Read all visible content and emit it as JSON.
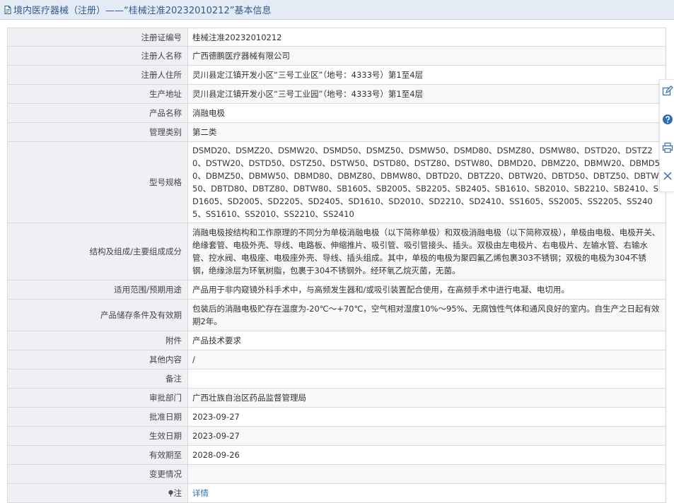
{
  "page": {
    "title": "境内医疗器械（注册）——“桂械注准20232010212”基本信息",
    "accent_color": "#2f6db5",
    "header_bg": "#e4ebf5"
  },
  "rows": [
    {
      "label": "注册证编号",
      "value": "桂械注准20232010212"
    },
    {
      "label": "注册人名称",
      "value": "广西德鹏医疗器械有限公司"
    },
    {
      "label": "注册人住所",
      "value": "灵川县定江镇开发小区“三号工业区”（地号：4333号）第1至4层"
    },
    {
      "label": "生产地址",
      "value": "灵川县定江镇开发小区“三号工业园”（地号：4333号）第1至4层"
    },
    {
      "label": "产品名称",
      "value": "消融电极"
    },
    {
      "label": "管理类别",
      "value": "第二类"
    },
    {
      "label": "型号规格",
      "value": "DSMD20、DSMZ20、DSMW20、DSMD50、DSMZ50、DSMW50、DSMD80、DSMZ80、DSMW80、DSTD20、DSTZ20、DSTW20、DSTD50、DSTZ50、DSTW50、DSTD80、DSTZ80、DSTW80、DBMD20、DBMZ20、DBMW20、DBMD50、DBMZ50、DBMW50、DBMD80、DBMZ80、DBMW80、DBTD20、DBTZ20、DBTW20、DBTD50、DBTZ50、DBTW50、DBTD80、DBTZ80、DBTW80、SB1605、SB2005、SB2205、SB2405、SB1610、SB2010、SB2210、SB2410、SD1605、SD2005、SD2205、SD2405、SD1610、SD2010、SD2210、SD2410、SS1605、SS2005、SS2205、SS2405、SS1610、SS2010、SS2210、SS2410"
    },
    {
      "label": "结构及组成/主要组成成分",
      "value": "消融电极按结构和工作原理的不同分为单极消融电极（以下简称单极）和双极消融电极（以下简称双极），单极由电极、电极开关、绝缘套管、电极外壳、导线、电路板、伸缩推片、吸引管、吸引管接头、插头。双极由左电极片、右电极片、左输水管、右输水管、控水阀、电极座、电极座外壳、导线、插头组成。其中，单极的电极为聚四氟乙烯包裹303不锈钢；双极的电极为304不锈钢，绝缘涂层为环氧树脂，包裹于304不锈钢外。经环氧乙烷灭菌，无菌。"
    },
    {
      "label": "适用范围/预期用途",
      "value": "产品用于非内窥镜外科手术中，与高频发生器和/或吸引装置配合使用，在高频手术中进行电凝、电切用。"
    },
    {
      "label": "产品储存条件及有效期",
      "value": "包装后的消融电极贮存在温度为-20℃～+70℃，空气相对湿度10%～95%、无腐蚀性气体和通风良好的室内。自生产之日起有效期2年。"
    },
    {
      "label": "附件",
      "value": "产品技术要求"
    },
    {
      "label": "其他内容",
      "value": "/"
    },
    {
      "label": "备注",
      "value": ""
    },
    {
      "label": "审批部门",
      "value": "广西壮族自治区药品监督管理局"
    },
    {
      "label": "批准日期",
      "value": "2023-09-27"
    },
    {
      "label": "生效日期",
      "value": "2023-09-27"
    },
    {
      "label": "有效期至",
      "value": "2028-09-26"
    },
    {
      "label": "变更情况",
      "value": ""
    },
    {
      "label": "注",
      "value": "详情"
    }
  ],
  "tools": [
    "edit-icon",
    "help-icon",
    "print-icon",
    "close-icon"
  ]
}
